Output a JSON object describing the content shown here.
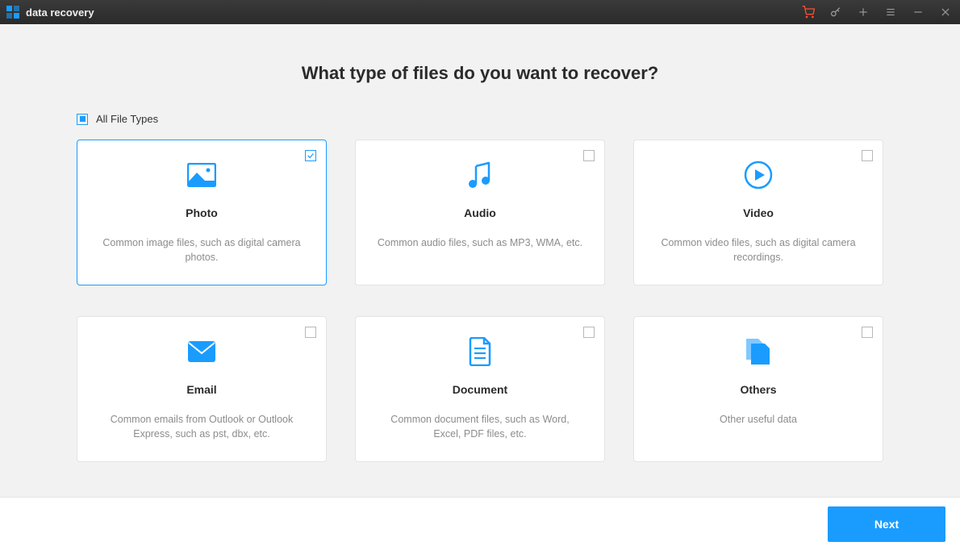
{
  "app": {
    "title": "data recovery"
  },
  "titlebar_icons": {
    "cart": "cart-icon",
    "key": "key-icon",
    "plus": "plus-icon",
    "menu": "menu-icon",
    "minimize": "minimize-icon",
    "close": "close-icon"
  },
  "heading": "What type of files do you want to recover?",
  "all_types": {
    "label": "All File Types",
    "checked": "indeterminate"
  },
  "cards": [
    {
      "title": "Photo",
      "desc": "Common image files, such as digital camera photos.",
      "selected": true,
      "icon": "image-icon"
    },
    {
      "title": "Audio",
      "desc": "Common audio files, such as MP3, WMA, etc.",
      "selected": false,
      "icon": "music-icon"
    },
    {
      "title": "Video",
      "desc": "Common video files, such as digital camera recordings.",
      "selected": false,
      "icon": "play-circle-icon"
    },
    {
      "title": "Email",
      "desc": "Common emails from Outlook or Outlook Express, such as pst, dbx, etc.",
      "selected": false,
      "icon": "envelope-icon"
    },
    {
      "title": "Document",
      "desc": "Common document files, such as Word, Excel, PDF files, etc.",
      "selected": false,
      "icon": "file-text-icon"
    },
    {
      "title": "Others",
      "desc": "Other useful data",
      "selected": false,
      "icon": "files-icon"
    }
  ],
  "footer": {
    "next_label": "Next"
  },
  "colors": {
    "accent": "#1a9cff",
    "cart": "#ff4d2e"
  }
}
